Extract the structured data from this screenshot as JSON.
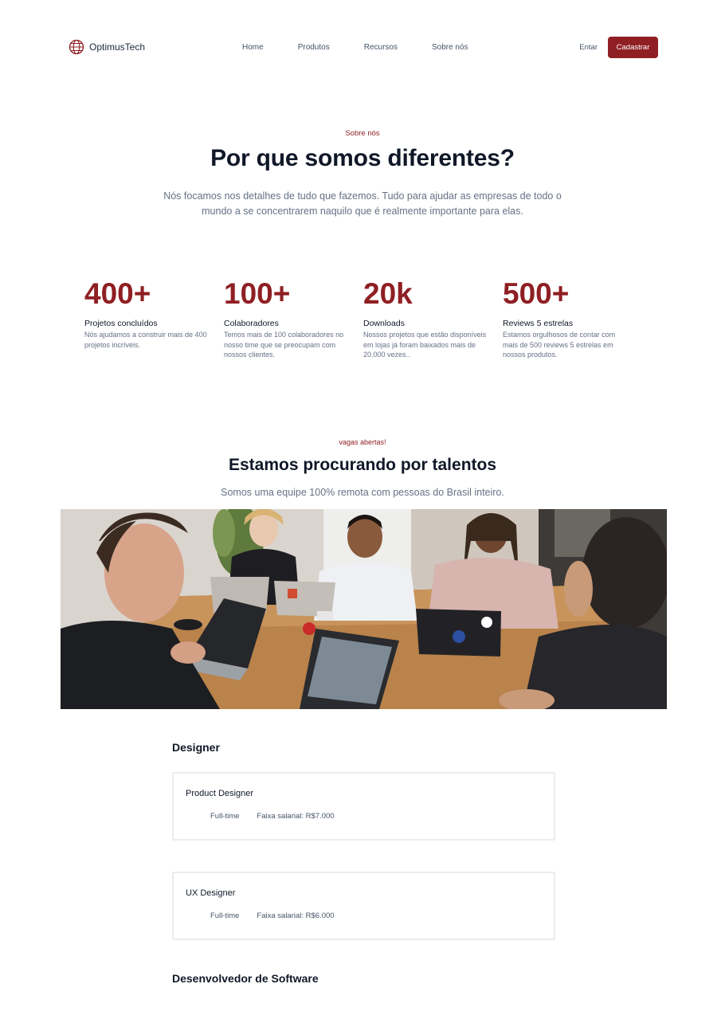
{
  "nav": {
    "brand": "OptimusTech",
    "brand_icon": "globe-icon",
    "links": [
      "Home",
      "Produtos",
      "Recursos",
      "Sobre nós"
    ],
    "login": "Entar",
    "signup": "Cadastrar"
  },
  "hero": {
    "eyebrow": "Sobre nós",
    "title": "Por que somos diferentes?",
    "subtitle": "Nós focamos nos detalhes de tudo que fazemos. Tudo para ajudar as empresas de todo o mundo a se concentrarem naquilo que é realmente importante para elas."
  },
  "stats": [
    {
      "value": "400+",
      "title": "Projetos concluídos",
      "desc": "Nós ajudamos a construir mais de 400 projetos incríveis."
    },
    {
      "value": "100+",
      "title": "Colaboradores",
      "desc": "Temos mais de 100 colaboradores no nosso time que se preocupam com nossos clientes."
    },
    {
      "value": "20k",
      "title": "Downloads",
      "desc": "Nossos projetos que estão disponíveis em lojas já foram baixados mais de 20.000 vezes.."
    },
    {
      "value": "500+",
      "title": "Reviews 5 estrelas",
      "desc": "Estamos orgulhosos de contar com mais de 500 reviews 5 estrelas em nossos produtos."
    }
  ],
  "talent": {
    "eyebrow": "vagas abertas!",
    "title": "Estamos procurando por talentos",
    "subtitle": "Somos uma equipe 100% remota com pessoas do Brasil inteiro."
  },
  "jobs": {
    "designer_heading": "Designer",
    "list": [
      {
        "title": "Product Designer",
        "type": "Full-time",
        "salary": "Faixa salarial: R$7.000"
      },
      {
        "title": "UX Designer",
        "type": "Full-time",
        "salary": "Faixa salarial: R$6.000"
      }
    ],
    "dev_heading": "Desenvolvedor de Software"
  },
  "colors": {
    "accent": "#8f1f23",
    "heading": "#101828",
    "muted": "#667085",
    "border": "#eaecf0"
  }
}
